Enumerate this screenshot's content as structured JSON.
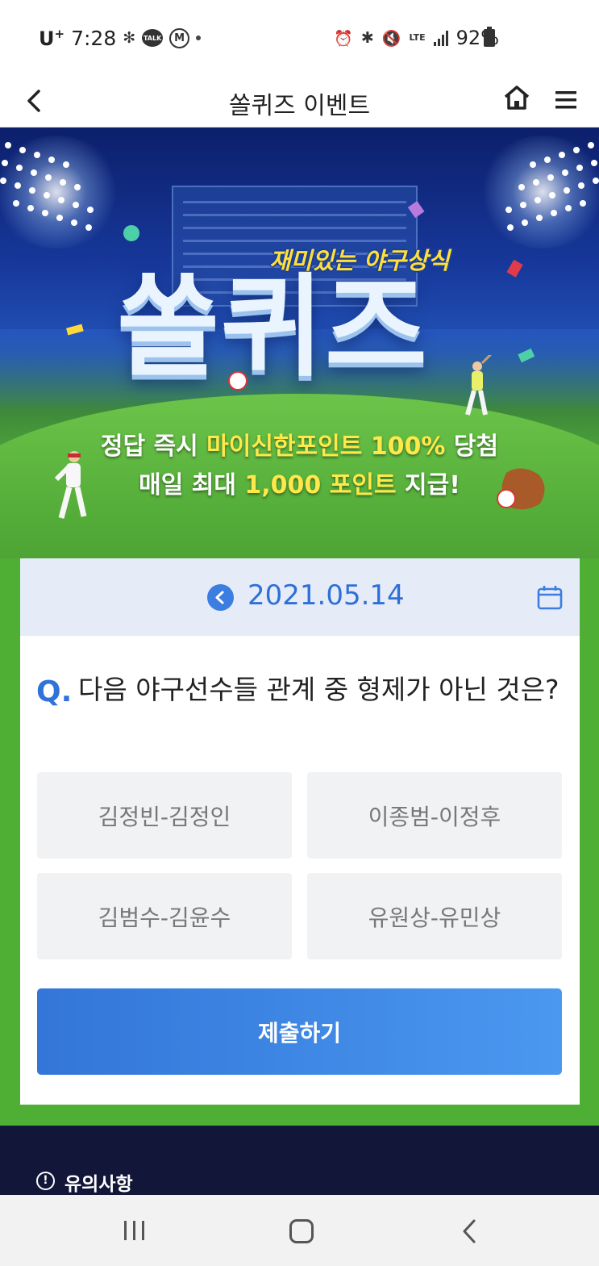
{
  "status_bar": {
    "carrier": "U",
    "carrier_sup": "+",
    "time": "7:28",
    "talk_label": "TALK",
    "m_label": "M",
    "network": "LTE",
    "battery": "92%"
  },
  "header": {
    "title": "쏠퀴즈 이벤트",
    "icons": [
      "back-icon",
      "home-icon",
      "menu-icon"
    ]
  },
  "banner": {
    "subtitle": "재미있는 야구상식",
    "logo_text": "쏠퀴즈",
    "promo_line1_a": "정답 즉시 ",
    "promo_line1_b": "마이신한포인트 100%",
    "promo_line1_c": " 당첨",
    "promo_line2_a": "매일 최대 ",
    "promo_line2_b": "1,000 포인트",
    "promo_line2_c": " 지급!",
    "accent_color": "#ffe94a"
  },
  "quiz": {
    "date": "2021.05.14",
    "question_mark": "Q.",
    "question": "다음 야구선수들 관계 중 형제가 아닌 것은?",
    "options": [
      "김정빈-김정인",
      "이종범-이정후",
      "김범수-김윤수",
      "유원상-유민상"
    ],
    "submit_label": "제출하기",
    "primary_color": "#3b7de0"
  },
  "notice": {
    "icon_text": "!",
    "label": "유의사항"
  }
}
